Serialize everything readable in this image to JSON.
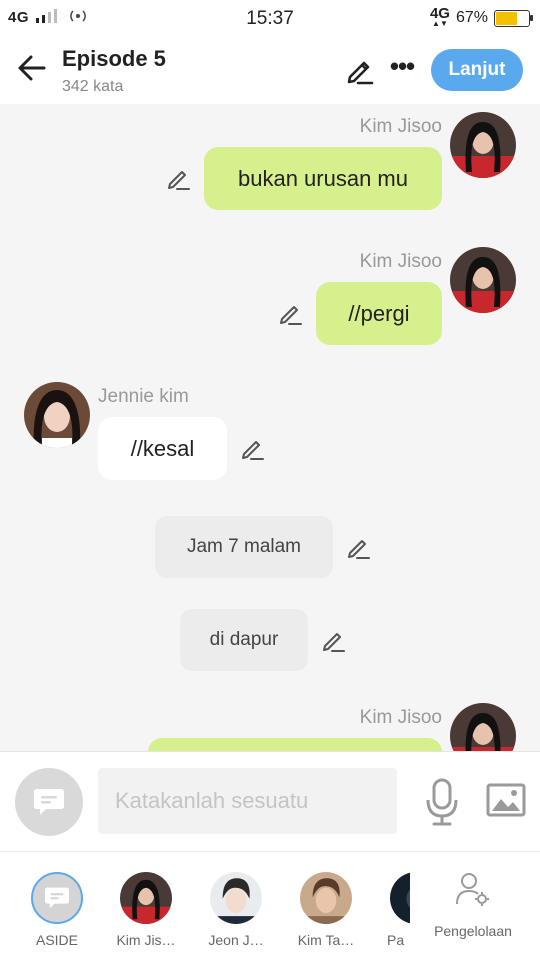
{
  "status_bar": {
    "network_left": "4G",
    "time": "15:37",
    "network_right": "4G",
    "battery": "67%"
  },
  "header": {
    "title": "Episode 5",
    "word_count": "342 kata",
    "next_label": "Lanjut"
  },
  "messages": [
    {
      "type": "right",
      "name": "Kim Jisoo",
      "text": "bukan urusan mu"
    },
    {
      "type": "right",
      "name": "Kim Jisoo",
      "text": "//pergi"
    },
    {
      "type": "left",
      "name": "Jennie kim",
      "text": "//kesal"
    },
    {
      "type": "narration",
      "text": "Jam 7 malam"
    },
    {
      "type": "narration",
      "text": "di dapur"
    },
    {
      "type": "right",
      "name": "Kim Jisoo",
      "text": ""
    }
  ],
  "input": {
    "placeholder": "Katakanlah sesuatu"
  },
  "characters": [
    {
      "label": "ASIDE"
    },
    {
      "label": "Kim Jis…"
    },
    {
      "label": "Jeon J…"
    },
    {
      "label": "Kim Ta…"
    },
    {
      "label": "Pa"
    }
  ],
  "manage_label": "Pengelolaan",
  "colors": {
    "accent": "#5aa8ee",
    "bubble_green": "#d7f08e",
    "bubble_white": "#ffffff",
    "narration_bg": "#ececec"
  },
  "icons": [
    "back-arrow-icon",
    "pencil-icon",
    "more-icon",
    "chat-bubble-icon",
    "mic-icon",
    "image-icon",
    "manage-user-icon"
  ]
}
